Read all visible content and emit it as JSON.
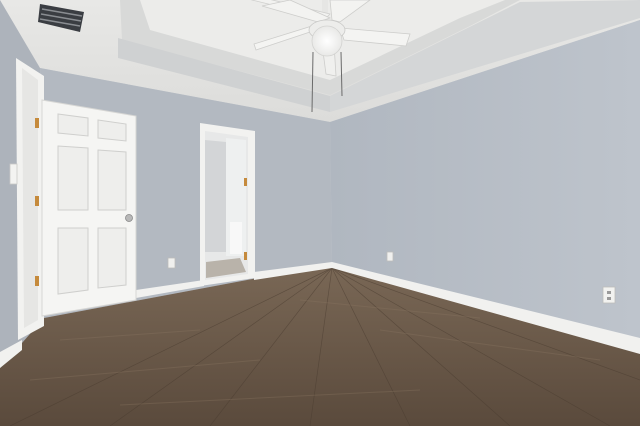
{
  "scene": {
    "kind": "empty bedroom interior photograph",
    "elements": [
      "ceiling-fan",
      "tray-ceiling",
      "air-vent",
      "panel-door-open",
      "bathroom-doorway",
      "light-switch",
      "electrical-outlets",
      "wood-laminate-floor",
      "white-baseboards"
    ]
  },
  "colors": {
    "wall": "#b4bac2",
    "wall_right": "#b9bfc7",
    "ceiling": "#e4e4e2",
    "tray": "#d9dad9",
    "floor": "#6b5a4a",
    "floor_dark": "#4f4033",
    "trim": "#f2f2f0",
    "door": "#f4f4f2",
    "hinge": "#c58a3c"
  }
}
